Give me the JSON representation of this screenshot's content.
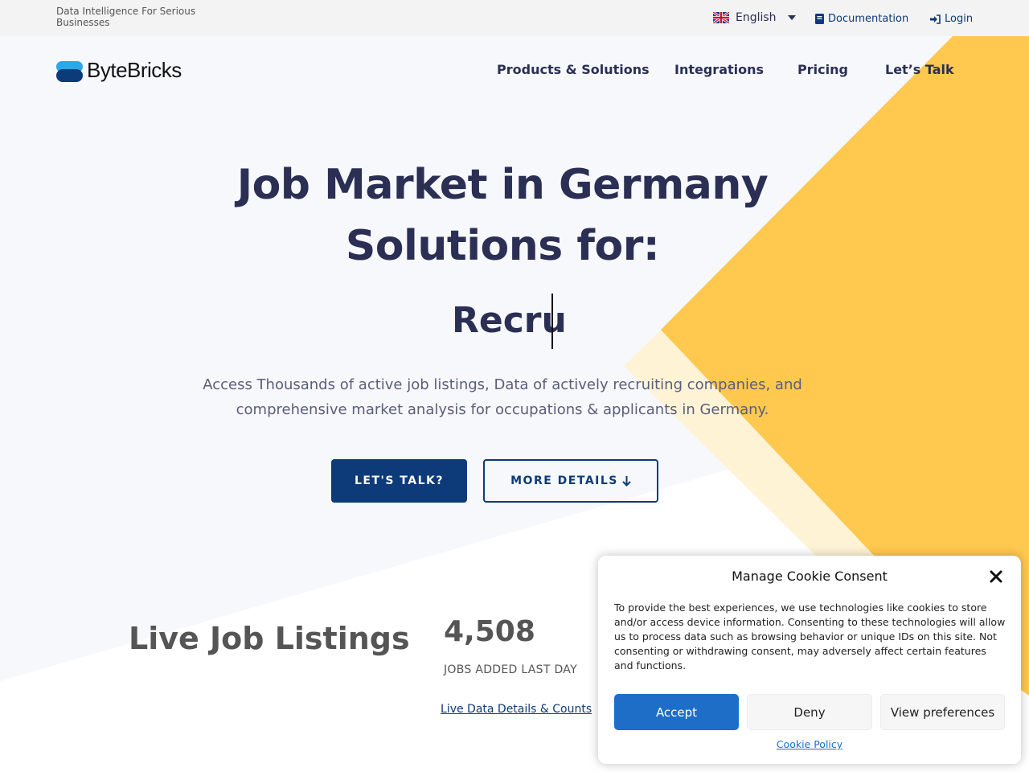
{
  "topbar": {
    "tagline": "Data Intelligence For Serious Businesses",
    "language": "English",
    "documentation": "Documentation",
    "login": "Login"
  },
  "header": {
    "brand": "ByteBricks",
    "nav": [
      "Products & Solutions",
      "Integrations",
      "Pricing",
      "Let’s Talk"
    ]
  },
  "hero": {
    "title_line1": "Job Market in Germany",
    "title_line2": "Solutions for:",
    "typed_text": "Recru",
    "subtitle": "Access Thousands of active job listings, Data of actively recruiting companies, and comprehensive market analysis for occupations & applicants in Germany.",
    "cta_primary": "LET'S TALK?",
    "cta_secondary": "MORE DETAILS"
  },
  "stats": {
    "title": "Live Job Listings",
    "count": "4,508",
    "count_label": "JOBS ADDED LAST DAY",
    "link": "Live Data Details & Counts"
  },
  "cookie": {
    "title": "Manage Cookie Consent",
    "text": "To provide the best experiences, we use technologies like cookies to store and/or access device information. Consenting to these technologies will allow us to process data such as browsing behavior or unique IDs on this site. Not consenting or withdrawing consent, may adversely affect certain features and functions.",
    "accept": "Accept",
    "deny": "Deny",
    "preferences": "View preferences",
    "policy": "Cookie Policy"
  },
  "colors": {
    "primary": "#0d3a78",
    "accent_yellow": "#ffc84e",
    "heading": "#2b2f54",
    "cookie_accept": "#1e6ec8"
  }
}
